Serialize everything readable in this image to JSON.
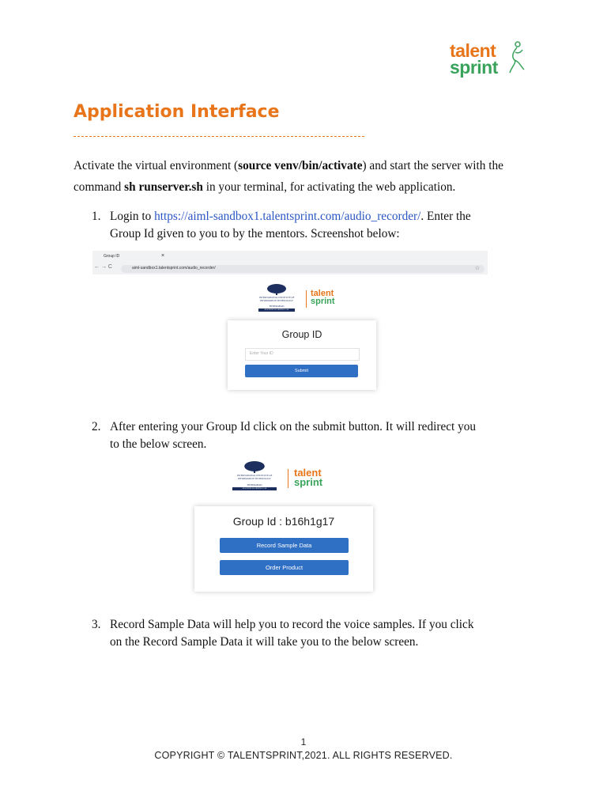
{
  "logo": {
    "word1": "talent",
    "word2": "sprint",
    "colors": {
      "orange": "#e8751a",
      "green": "#3aa35b"
    }
  },
  "heading": "Application Interface",
  "intro": {
    "before_cmd1": "Activate the virtual environment (",
    "cmd1": "source venv/bin/activate",
    "after_cmd1": ") and start the server with the command ",
    "cmd2": "sh runserver.sh",
    "after_cmd2": " in your terminal, for activating the web application."
  },
  "steps": [
    {
      "num": "1.",
      "before_link": "Login to ",
      "link": "https://aiml-sandbox1.talentsprint.com/audio_recorder/",
      "after_link": ". Enter the Group Id given to you to by the mentors. Screenshot below:"
    },
    {
      "num": "2.",
      "text": "After entering your Group Id click on the submit button. It will redirect you to the below screen."
    },
    {
      "num": "3.",
      "text": "Record Sample Data will help you to record the voice samples. If you click on the Record Sample Data it will take you to the below screen."
    }
  ],
  "screenshot1": {
    "tab_title": "Group ID",
    "tab_close": "×",
    "nav": "← → C",
    "url": "aiml-sandbox1.talentsprint.com/audio_recorder/",
    "star": "☆",
    "iiit_line": "INTERNATIONAL INSTITUTE OF INFORMATION TECHNOLOGY",
    "iiit_city": "HYDERABAD",
    "iiit_bar": "MACHINE LEARNING LAB",
    "card_title": "Group ID",
    "input_placeholder": "Enter Your ID",
    "submit_label": "Submit"
  },
  "screenshot2": {
    "iiit_line": "INTERNATIONAL INSTITUTE OF INFORMATION TECHNOLOGY",
    "iiit_city": "HYDERABAD",
    "iiit_bar": "MACHINE LEARNING LAB",
    "group_label": "Group Id : b16h1g17",
    "btn_record": "Record Sample Data",
    "btn_order": "Order Product"
  },
  "footer": {
    "page": "1",
    "copyright": "COPYRIGHT © TALENTSPRINT,2021. ALL RIGHTS RESERVED."
  },
  "accent_colors": {
    "heading": "#e8751a",
    "link": "#2a55c4",
    "button": "#2f6fc4"
  }
}
